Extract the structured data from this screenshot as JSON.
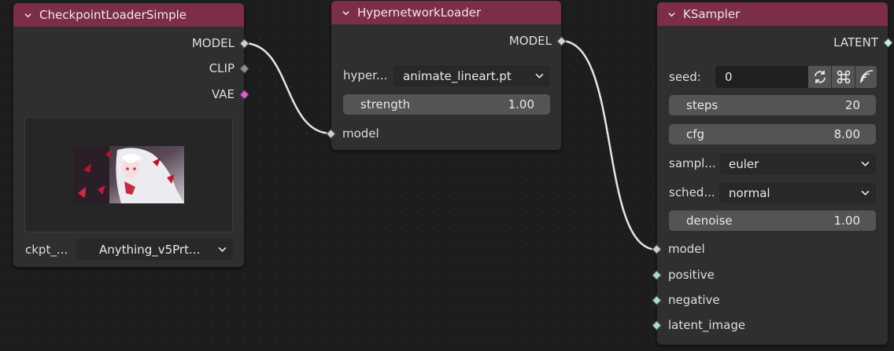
{
  "checkpoint_loader": {
    "title": "CheckpointLoaderSimple",
    "outputs": [
      "MODEL",
      "CLIP",
      "VAE"
    ],
    "ckpt_label": "ckpt_...",
    "ckpt_value": "Anything_v5Prt..."
  },
  "hypernetwork_loader": {
    "title": "HypernetworkLoader",
    "output": "MODEL",
    "hyper_label": "hyper...",
    "hyper_value": "animate_lineart.pt",
    "strength_label": "strength",
    "strength_value": "1.00",
    "input": "model"
  },
  "ksampler": {
    "title": "KSampler",
    "output": "LATENT",
    "seed_label": "seed:",
    "seed_value": "0",
    "steps_label": "steps",
    "steps_value": "20",
    "cfg_label": "cfg",
    "cfg_value": "8.00",
    "sampler_label": "sampl...",
    "sampler_value": "euler",
    "scheduler_label": "sched...",
    "scheduler_value": "normal",
    "denoise_label": "denoise",
    "denoise_value": "1.00",
    "inputs": [
      "model",
      "positive",
      "negative",
      "latent_image"
    ]
  },
  "colors": {
    "header": "#7c2d48",
    "node_bg": "#2f2f2f",
    "wire": "#e6e6dc",
    "vae_socket": "#e05be0"
  }
}
